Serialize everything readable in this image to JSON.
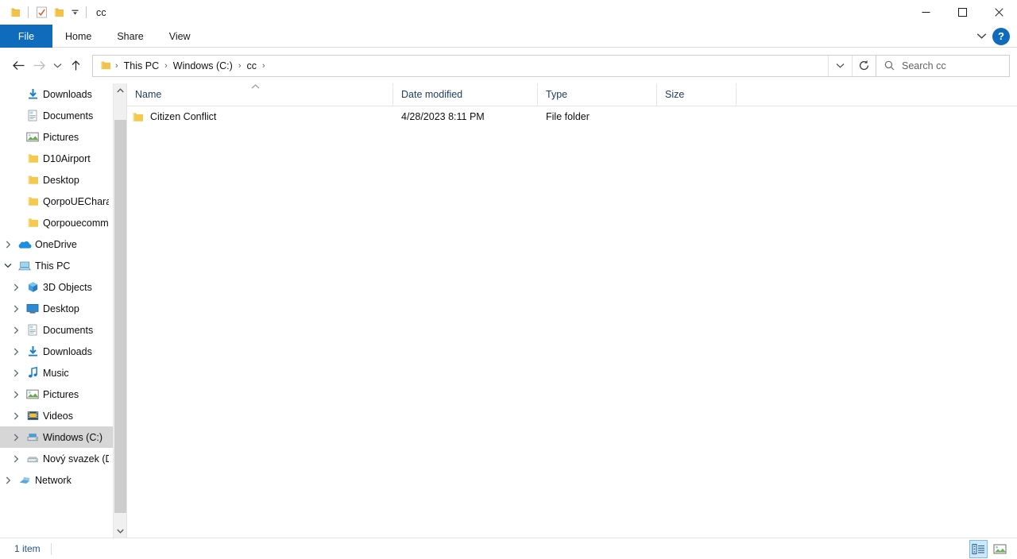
{
  "titlebar": {
    "title": "cc",
    "quick_access": [
      {
        "name": "folder-icon",
        "label": "Folder"
      },
      {
        "name": "properties-icon",
        "label": "Properties"
      },
      {
        "name": "new-folder-icon",
        "label": "New folder"
      },
      {
        "name": "chevron-down-icon",
        "label": "Customize Quick Access Toolbar"
      }
    ],
    "controls": {
      "minimize": "─",
      "maximize": "□",
      "close": "✕"
    }
  },
  "ribbon": {
    "tabs": [
      {
        "label": "File",
        "active": true
      },
      {
        "label": "Home",
        "active": false
      },
      {
        "label": "Share",
        "active": false
      },
      {
        "label": "View",
        "active": false
      }
    ],
    "collapse_icon": "chevron-down-icon",
    "help_label": "?"
  },
  "address": {
    "back": "←",
    "forward": "→",
    "recent": "⌄",
    "up": "↑",
    "breadcrumbs": [
      {
        "label": "This PC"
      },
      {
        "label": "Windows (C:)"
      },
      {
        "label": "cc"
      }
    ],
    "separator": "›",
    "dropdown_icon": "chevron-down-icon",
    "refresh_icon": "refresh-icon"
  },
  "search": {
    "placeholder": "Search cc",
    "icon": "search-icon"
  },
  "navpane": {
    "items": [
      {
        "label": "Downloads",
        "icon": "download-icon",
        "indent": 1,
        "chevron": "",
        "pinned": true,
        "selected": false
      },
      {
        "label": "Documents",
        "icon": "documents-icon",
        "indent": 1,
        "chevron": "",
        "pinned": true,
        "selected": false
      },
      {
        "label": "Pictures",
        "icon": "pictures-icon",
        "indent": 1,
        "chevron": "",
        "pinned": true,
        "selected": false
      },
      {
        "label": "D10Airport",
        "icon": "folder-icon",
        "indent": 1,
        "chevron": "",
        "pinned": false,
        "selected": false
      },
      {
        "label": "Desktop",
        "icon": "folder-icon",
        "indent": 1,
        "chevron": "",
        "pinned": false,
        "selected": false
      },
      {
        "label": "QorpoUECharact",
        "icon": "folder-icon",
        "indent": 1,
        "chevron": "",
        "pinned": false,
        "selected": false
      },
      {
        "label": "Qorpouecommo",
        "icon": "folder-icon",
        "indent": 1,
        "chevron": "",
        "pinned": false,
        "selected": false
      },
      {
        "label": "OneDrive",
        "icon": "onedrive-icon",
        "indent": 0,
        "chevron": "collapsed",
        "pinned": false,
        "selected": false
      },
      {
        "label": "This PC",
        "icon": "thispc-icon",
        "indent": 0,
        "chevron": "expanded",
        "pinned": false,
        "selected": false
      },
      {
        "label": "3D Objects",
        "icon": "3dobjects-icon",
        "indent": 1,
        "chevron": "collapsed",
        "pinned": false,
        "selected": false
      },
      {
        "label": "Desktop",
        "icon": "desktop-icon",
        "indent": 1,
        "chevron": "collapsed",
        "pinned": false,
        "selected": false
      },
      {
        "label": "Documents",
        "icon": "documents-icon",
        "indent": 1,
        "chevron": "collapsed",
        "pinned": false,
        "selected": false
      },
      {
        "label": "Downloads",
        "icon": "download-icon",
        "indent": 1,
        "chevron": "collapsed",
        "pinned": false,
        "selected": false
      },
      {
        "label": "Music",
        "icon": "music-icon",
        "indent": 1,
        "chevron": "collapsed",
        "pinned": false,
        "selected": false
      },
      {
        "label": "Pictures",
        "icon": "pictures-icon",
        "indent": 1,
        "chevron": "collapsed",
        "pinned": false,
        "selected": false
      },
      {
        "label": "Videos",
        "icon": "videos-icon",
        "indent": 1,
        "chevron": "collapsed",
        "pinned": false,
        "selected": false
      },
      {
        "label": "Windows (C:)",
        "icon": "drive-icon",
        "indent": 1,
        "chevron": "collapsed",
        "pinned": false,
        "selected": true
      },
      {
        "label": "Nový svazek (D:)",
        "icon": "drive-plain-icon",
        "indent": 1,
        "chevron": "collapsed",
        "pinned": false,
        "selected": false
      },
      {
        "label": "Network",
        "icon": "network-icon",
        "indent": 0,
        "chevron": "collapsed",
        "pinned": false,
        "selected": false
      }
    ]
  },
  "filelist": {
    "columns": [
      {
        "label": "Name",
        "sorted": "asc"
      },
      {
        "label": "Date modified",
        "sorted": ""
      },
      {
        "label": "Type",
        "sorted": ""
      },
      {
        "label": "Size",
        "sorted": ""
      }
    ],
    "rows": [
      {
        "name": "Citizen Conflict",
        "date_modified": "4/28/2023 8:11 PM",
        "type": "File folder",
        "size": "",
        "icon": "folder-icon"
      }
    ]
  },
  "statusbar": {
    "item_count": "1 item",
    "views": [
      {
        "name": "details-view-button",
        "active": true
      },
      {
        "name": "large-icons-view-button",
        "active": false
      }
    ]
  },
  "colors": {
    "accent": "#0f6cbd",
    "folder": "#f7ce63",
    "selection": "#d6d6d6",
    "header_text": "#1f3f66"
  }
}
